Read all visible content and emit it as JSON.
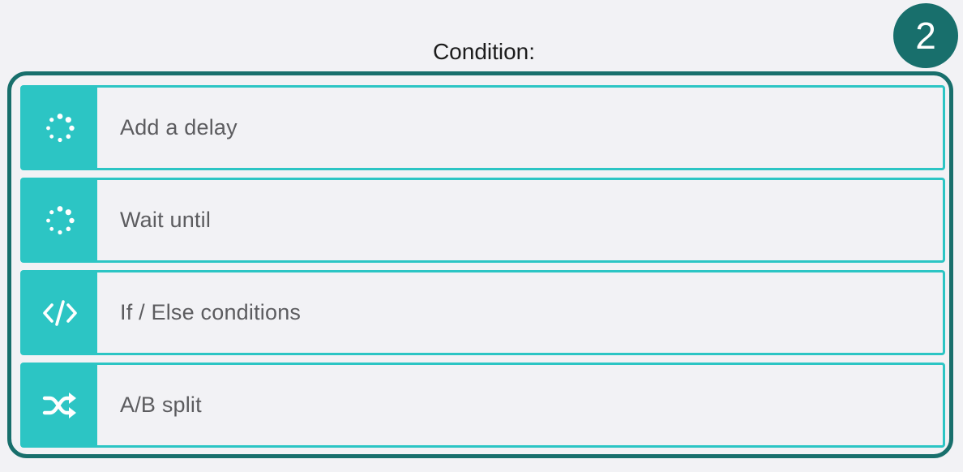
{
  "step_badge": "2",
  "title": "Condition:",
  "options": [
    {
      "label": "Add a delay",
      "icon": "spinner-icon"
    },
    {
      "label": "Wait until",
      "icon": "spinner-icon"
    },
    {
      "label": "If / Else conditions",
      "icon": "code-icon"
    },
    {
      "label": "A/B split",
      "icon": "shuffle-icon"
    }
  ],
  "colors": {
    "accent": "#2cc5c4",
    "dark_teal": "#186f6c",
    "background": "#f2f2f5",
    "label_text": "#5c5c5f"
  }
}
